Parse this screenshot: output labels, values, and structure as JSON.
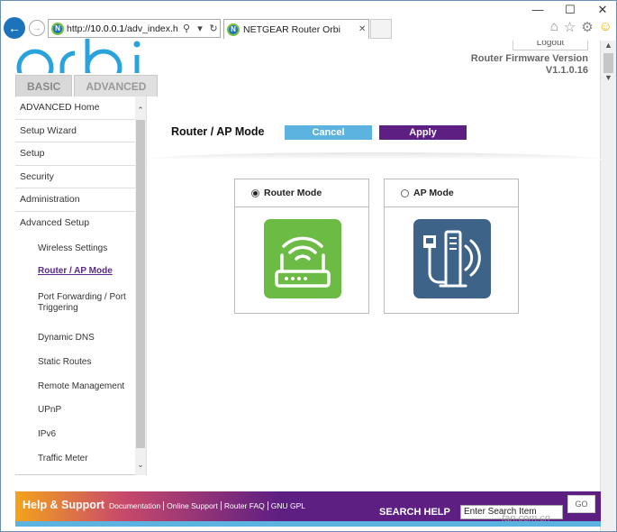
{
  "window": {
    "controls": [
      "—",
      "☐",
      "✕"
    ]
  },
  "browser": {
    "url_prefix": "http://",
    "url_host": "10.0.0.1",
    "url_path": "/adv_index.htm",
    "tab_title": "NETGEAR Router Orbi",
    "favicon_letter": "N"
  },
  "header": {
    "logo_text": "orbi",
    "logout_label": "Logout",
    "fw_label": "Router Firmware Version",
    "fw_version": "V1.1.0.16",
    "tabs": [
      {
        "label": "BASIC",
        "active": false
      },
      {
        "label": "ADVANCED",
        "active": true
      }
    ]
  },
  "sidebar": {
    "items": [
      {
        "label": "ADVANCED Home"
      },
      {
        "label": "Setup Wizard"
      },
      {
        "label": "Setup"
      },
      {
        "label": "Security"
      },
      {
        "label": "Administration"
      },
      {
        "label": "Advanced Setup"
      }
    ],
    "subitems": [
      {
        "label": "Wireless Settings",
        "active": false
      },
      {
        "label": "Router / AP Mode",
        "active": true
      },
      {
        "label": "Port Forwarding / Port Triggering",
        "active": false
      },
      {
        "label": "Dynamic DNS",
        "active": false
      },
      {
        "label": "Static Routes",
        "active": false
      },
      {
        "label": "Remote Management",
        "active": false
      },
      {
        "label": "UPnP",
        "active": false
      },
      {
        "label": "IPv6",
        "active": false
      },
      {
        "label": "Traffic Meter",
        "active": false
      }
    ]
  },
  "main": {
    "title": "Router / AP Mode",
    "cancel_label": "Cancel",
    "apply_label": "Apply",
    "modes": [
      {
        "label": "Router Mode",
        "selected": true,
        "icon": "router-icon",
        "color": "#6cbb45"
      },
      {
        "label": "AP Mode",
        "selected": false,
        "icon": "access-point-icon",
        "color": "#3d6388"
      }
    ]
  },
  "footer": {
    "help_title": "Help & Support",
    "links": [
      "Documentation",
      "Online Support",
      "Router FAQ",
      "GNU GPL"
    ],
    "search_label": "SEARCH HELP",
    "search_value": "Enter Search Item",
    "go_label": "GO"
  },
  "watermark": "fan.com.cn",
  "colors": {
    "accent_purple": "#5e1f82",
    "accent_blue": "#5db3e0",
    "router_green": "#6cbb45",
    "ap_blue": "#3d6388"
  }
}
